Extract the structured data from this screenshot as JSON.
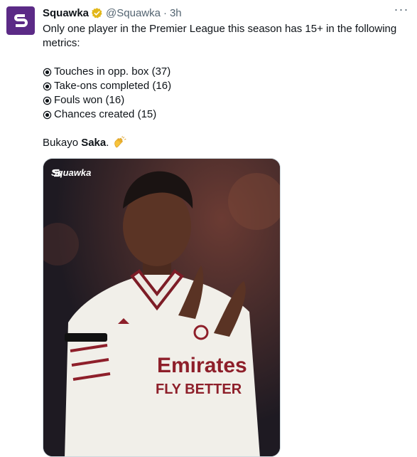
{
  "tweet": {
    "display_name": "Squawka",
    "handle": "@Squawka",
    "separator": "·",
    "time": "3h",
    "more_label": "···",
    "verified": true,
    "accent_color": "#5b2a86",
    "text_intro_line1": "Only one player in the Premier League this season has 15+ in the following",
    "text_intro_line2": "metrics:",
    "bullets": [
      {
        "icon": "radio-button-icon",
        "text": "Touches in opp. box (37)"
      },
      {
        "icon": "radio-button-icon",
        "text": "Take-ons completed (16)"
      },
      {
        "icon": "radio-button-icon",
        "text": "Fouls won (16)"
      },
      {
        "icon": "radio-button-icon",
        "text": "Chances created (15)"
      }
    ],
    "signoff_first": "Bukayo ",
    "signoff_bold": "Saka",
    "signoff_end": ".",
    "signoff_emoji": "clapping-hands-icon"
  },
  "media": {
    "logo_text": "Squawka",
    "description_icon": "player-photo"
  }
}
